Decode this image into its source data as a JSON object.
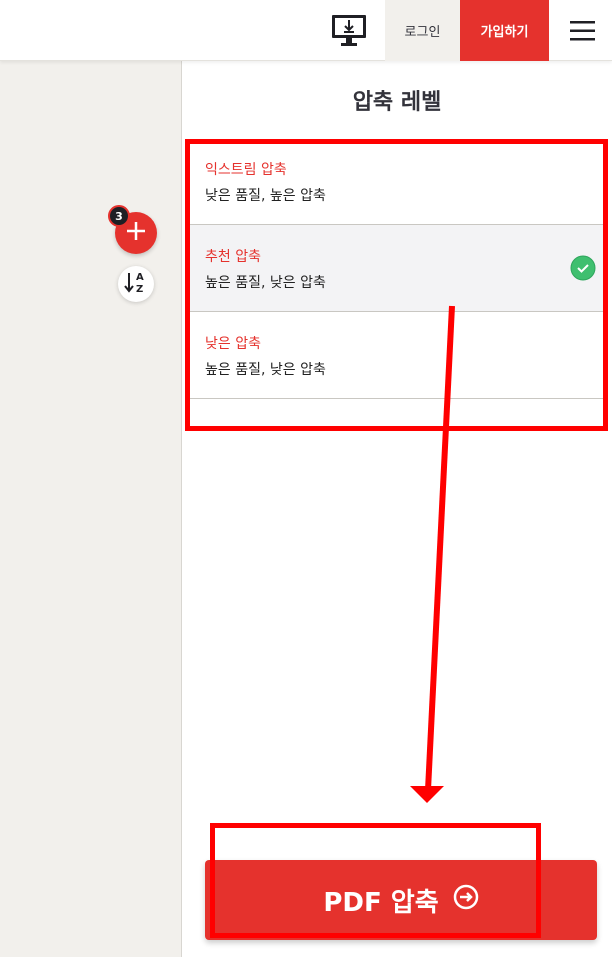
{
  "header": {
    "desktop_icon": "desktop-download-icon",
    "login_label": "로그인",
    "signup_label": "가입하기",
    "menu_icon": "hamburger-menu-icon"
  },
  "sidebar": {
    "file_count": "3",
    "add_icon": "plus-icon",
    "sort_icon": "sort-az-icon"
  },
  "panel": {
    "title": "압축 레벨",
    "options": [
      {
        "title": "익스트림 압축",
        "desc": "낮은 품질, 높은 압축",
        "selected": false
      },
      {
        "title": "추천 압축",
        "desc": "높은 품질, 낮은 압축",
        "selected": true
      },
      {
        "title": "낮은 압축",
        "desc": "높은 품질, 낮은 압축",
        "selected": false
      }
    ]
  },
  "action": {
    "compress_label": "PDF 압축",
    "arrow_icon": "arrow-right-circle-icon"
  },
  "colors": {
    "accent": "#e5322d",
    "check": "#3fbf6f",
    "annotation": "#ff0000"
  }
}
